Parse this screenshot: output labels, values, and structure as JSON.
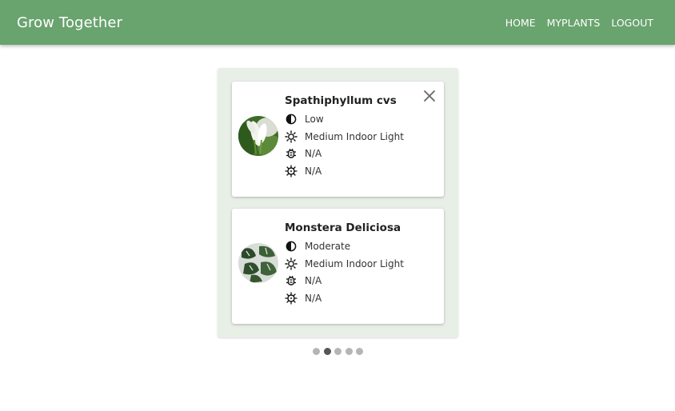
{
  "appbar": {
    "brand": "Grow Together",
    "nav": [
      "HOME",
      "MYPLANTS",
      "LOGOUT"
    ]
  },
  "plants": [
    {
      "name": "Spathiphyllum cvs",
      "water": "Low",
      "light": "Medium Indoor Light",
      "pests": "N/A",
      "disease": "N/A",
      "image_icon": "peace-lily-photo"
    },
    {
      "name": "Monstera Deliciosa",
      "water": "Moderate",
      "light": "Medium Indoor Light",
      "pests": "N/A",
      "disease": "N/A",
      "image_icon": "monstera-photo"
    }
  ],
  "pagination": {
    "count": 5,
    "active_index": 1
  },
  "colors": {
    "appbar": "#69a36e",
    "panel": "#e8efe7",
    "dot": "#b5b5b5",
    "dot_active": "#555555"
  },
  "icons": {
    "water": "contrast-half-circle-icon",
    "light": "sun-icon",
    "pests": "bug-icon",
    "disease": "virus-icon",
    "close": "close-icon"
  }
}
